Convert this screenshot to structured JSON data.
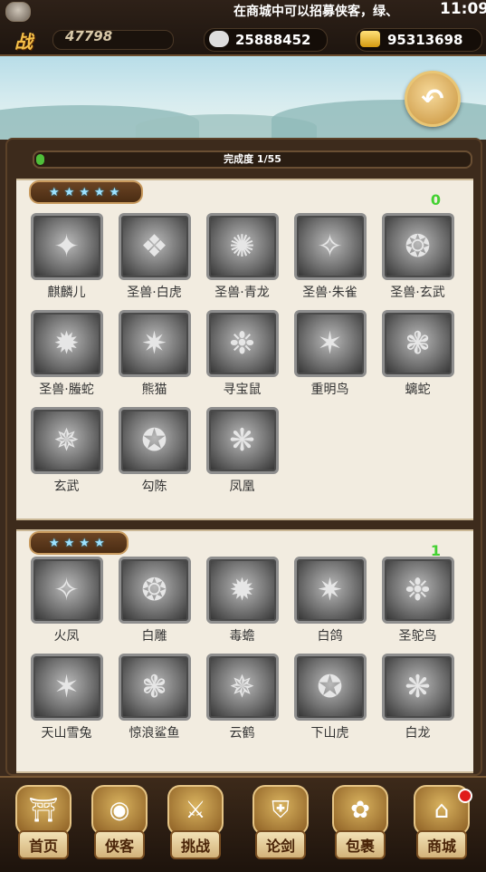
{
  "status": {
    "marquee": "在商城中可以招募侠客，绿、",
    "time": "11:09"
  },
  "header": {
    "power_badge": "战力",
    "power_value": "47798",
    "silver": "25888452",
    "gold": "95313698"
  },
  "progress": {
    "label": "完成度 1/55",
    "fraction": 0.0182
  },
  "sections": [
    {
      "stars": 5,
      "count": "0",
      "items": [
        "麒麟儿",
        "圣兽·白虎",
        "圣兽·青龙",
        "圣兽·朱雀",
        "圣兽·玄武",
        "圣兽·螣蛇",
        "熊猫",
        "寻宝鼠",
        "重明鸟",
        "螭蛇",
        "玄武",
        "勾陈",
        "凤凰"
      ]
    },
    {
      "stars": 4,
      "count": "1",
      "items": [
        "火凤",
        "白雕",
        "毒蟾",
        "白鸽",
        "圣鸵鸟",
        "天山雪兔",
        "惊浪鲨鱼",
        "云鹤",
        "下山虎",
        "白龙"
      ]
    }
  ],
  "nav": [
    {
      "label": "首页",
      "icon": "palace-icon"
    },
    {
      "label": "侠客",
      "icon": "egg-icon"
    },
    {
      "label": "挑战",
      "icon": "crossed-swords-icon"
    },
    {
      "label": "论剑",
      "icon": "shield-icon"
    },
    {
      "label": "包裹",
      "icon": "bag-icon"
    },
    {
      "label": "商城",
      "icon": "shop-icon"
    }
  ],
  "colors": {
    "progress_fill": "#4fbf3a",
    "count": "#44d132",
    "star": "#9fe3ff"
  }
}
